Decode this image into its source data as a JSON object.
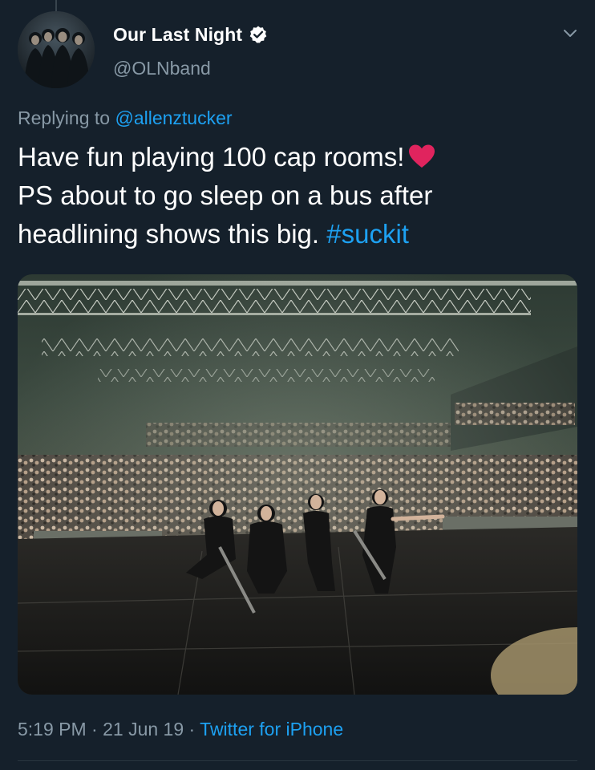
{
  "tweet": {
    "author": {
      "display_name": "Our Last Night",
      "handle": "@OLNband",
      "verified": true
    },
    "reply": {
      "prefix": "Replying to ",
      "mention": "@allenztucker"
    },
    "text": {
      "line1": "Have fun playing 100 cap rooms!",
      "line2": "PS about to go sleep on a bus after",
      "line3": "headlining shows this big.",
      "hashtag": "#suckit"
    },
    "meta": {
      "time": "5:19 PM",
      "separator": " · ",
      "date": "21 Jun 19",
      "source": "Twitter for iPhone"
    }
  },
  "icons": {
    "verified": "verified-badge-icon",
    "options": "chevron-down-icon",
    "emoji": "red-heart-icon"
  },
  "colors": {
    "background": "#15202b",
    "primary_text": "#ffffff",
    "secondary_text": "#8899a6",
    "accent_link": "#1da1f2",
    "heart": "#e0245e"
  }
}
